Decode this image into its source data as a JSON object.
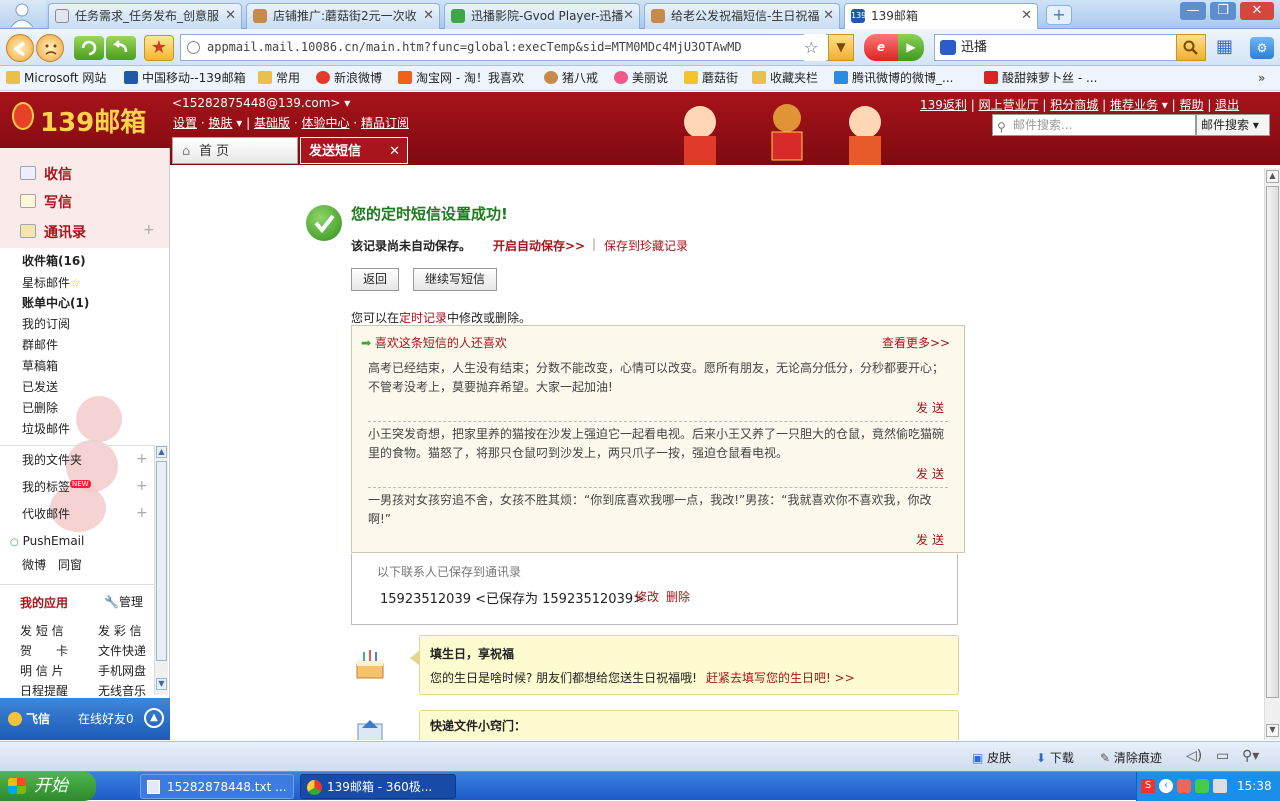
{
  "browser": {
    "tabs": [
      {
        "title": "任务需求_任务发布_创意服",
        "active": false
      },
      {
        "title": "店铺推广:蘑菇街2元一次收",
        "active": false
      },
      {
        "title": "迅播影院-Gvod Player-迅播",
        "active": false
      },
      {
        "title": "给老公发祝福短信-生日祝福",
        "active": false
      },
      {
        "title": "139邮箱",
        "active": true
      }
    ],
    "url": "appmail.mail.10086.cn/main.htm?func=global:execTemp&sid=MTM0MDc4MjU3OTAwMD",
    "search_value": "迅播",
    "bookmarks": [
      "Microsoft 网站",
      "中国移动--139邮箱",
      "常用",
      "新浪微博",
      "淘宝网 - 淘！我喜欢",
      "猪八戒",
      "美丽说",
      "蘑菇街",
      "收藏夹栏",
      "腾讯微博的微博_...",
      "酸甜辣萝卜丝 - ..."
    ]
  },
  "mail_header": {
    "logo": "139邮箱",
    "account": "<15282875448@139.com>",
    "links_left": [
      "设置",
      "换肤",
      "基础版",
      "体验中心",
      "精品订阅"
    ],
    "links_right": [
      "139返利",
      "网上营业厅",
      "积分商城",
      "推荐业务",
      "帮助",
      "退出"
    ],
    "search_placeholder": "邮件搜索...",
    "search_type": "邮件搜索",
    "tabs": [
      "首 页",
      "发送短信"
    ]
  },
  "sidebar": {
    "primary": [
      "收信",
      "写信",
      "通讯录"
    ],
    "folders": [
      "收件箱(16)",
      "星标邮件",
      "账单中心(1)",
      "我的订阅",
      "群邮件",
      "草稿箱",
      "已发送",
      "已删除",
      "垃圾邮件"
    ],
    "groups": [
      "我的文件夹",
      "我的标签",
      "代收邮件"
    ],
    "new_badge": "NEW",
    "pushemail": "PushEmail",
    "links": [
      "微博",
      "同窗"
    ],
    "apps_title": "我的应用",
    "apps_manage": "管理",
    "apps": [
      "发 短 信",
      "发 彩 信",
      "贺　　卡",
      "文件快递",
      "明 信 片",
      "手机网盘",
      "日程提醒",
      "无线音乐"
    ],
    "feixin": "飞信",
    "online": "在线好友0"
  },
  "main": {
    "success_title": "您的定时短信设置成功!",
    "not_saved": "该记录尚未自动保存。",
    "auto_save": "开启自动保存>>",
    "save_fav": "保存到珍藏记录",
    "btn_back": "返回",
    "btn_continue": "继续写短信",
    "edit_prefix": "您可以在",
    "edit_link": "定时记录",
    "edit_suffix": "中修改或删除。",
    "like_title": "喜欢这条短信的人还喜欢",
    "see_more": "查看更多>>",
    "send": "发送",
    "sms": [
      "高考已经结束，人生没有结束；分数不能改变，心情可以改变。愿所有朋友，无论高分低分，分秒都要开心；不管考没考上，莫要抛弃希望。大家一起加油!",
      "小王突发奇想，把家里养的猫按在沙发上强迫它一起看电视。后来小王又养了一只胆大的仓鼠，竟然偷吃猫碗里的食物。猫怒了，将那只仓鼠叼到沙发上，两只爪子一按，强迫仓鼠看电视。",
      "一男孩对女孩穷追不舍，女孩不胜其烦：“你到底喜欢我哪一点，我改!”男孩：“我就喜欢你不喜欢我，你改啊!”"
    ],
    "contacts_saved": "以下联系人已保存到通讯录",
    "contact_line": "15923512039 <已保存为 15923512039>",
    "edit": "修改",
    "delete": "删除",
    "bday_title": "填生日，享祝福",
    "bday_text": "您的生日是啥时候? 朋友们都想给您送生日祝福哦!",
    "bday_link": "赶紧去填写您的生日吧! >>",
    "express_title": "快递文件小窍门："
  },
  "statusbar": {
    "items": [
      "皮肤",
      "下载",
      "清除痕迹"
    ]
  },
  "taskbar": {
    "start": "开始",
    "tasks": [
      "15282878448.txt ...",
      "139邮箱 - 360极..."
    ],
    "clock": "15:38"
  },
  "colors": {
    "brand": "#a8151c",
    "success": "#1d7a1d",
    "taskbar": "#1e5cc8"
  }
}
